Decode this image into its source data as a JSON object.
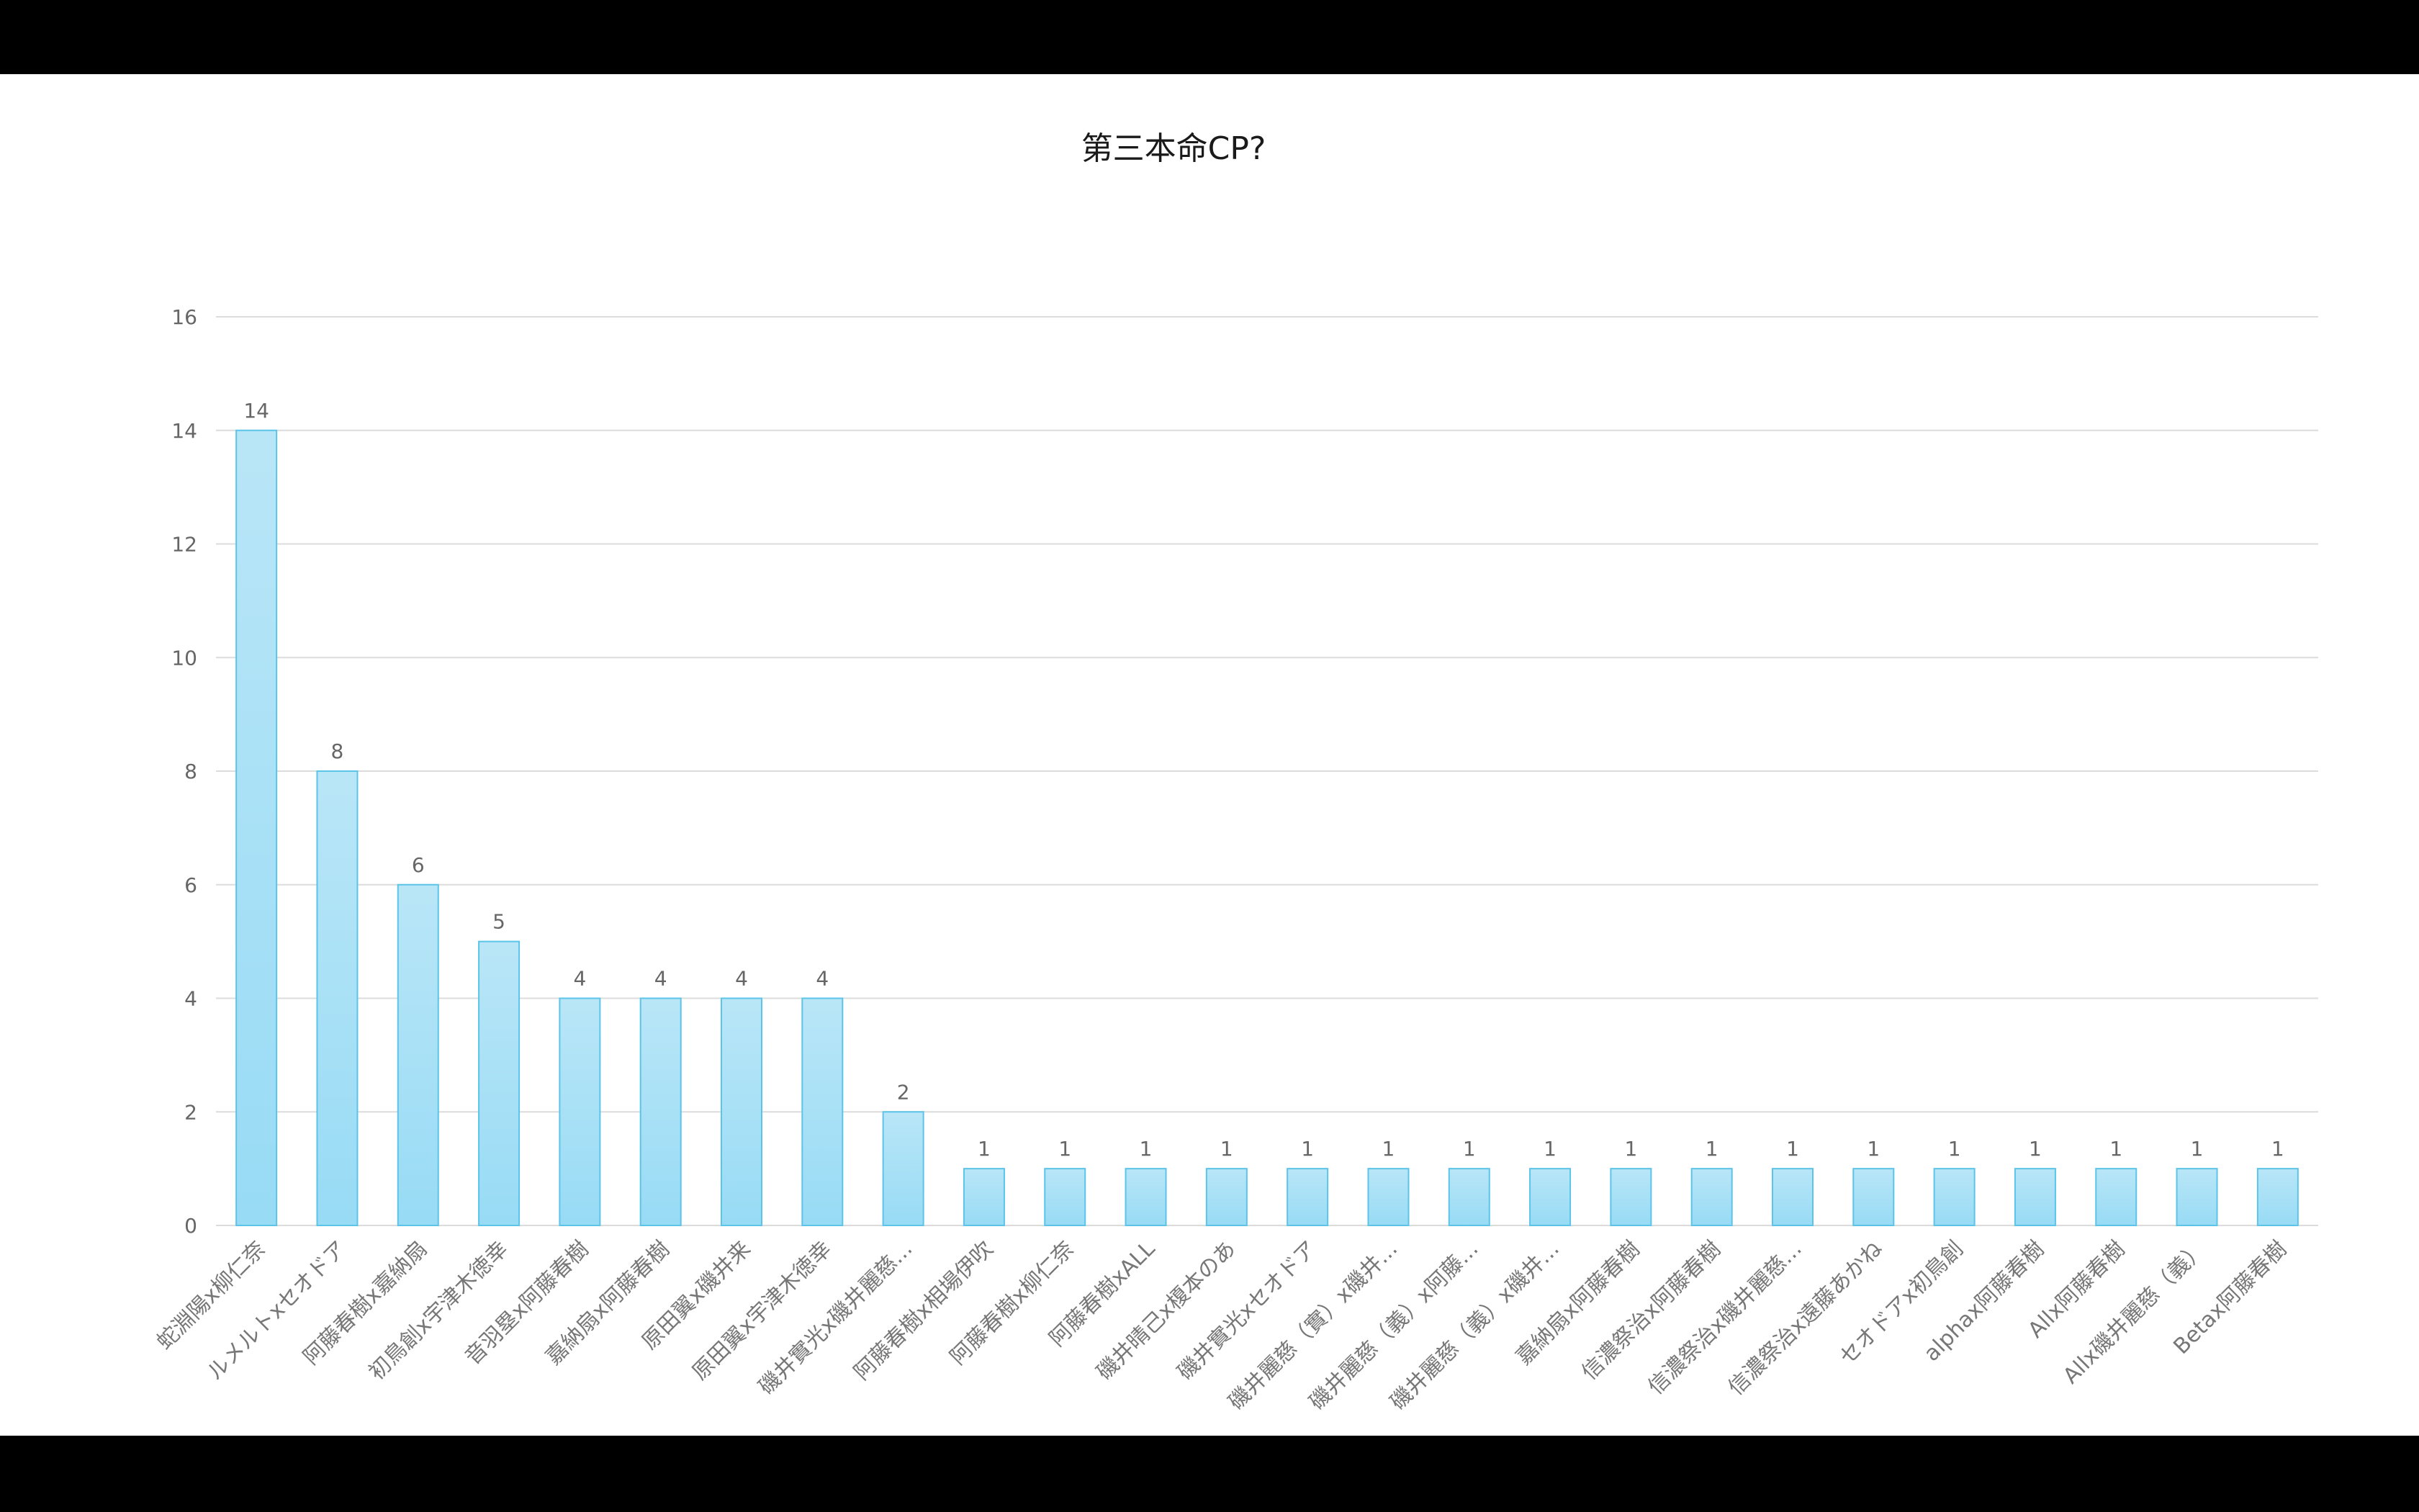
{
  "colors": {
    "background": "#ffffff",
    "frame": "#000000",
    "bar_fill_top": "#b9e6f7",
    "bar_fill_bottom": "#98dbf5",
    "bar_stroke": "#5bc4e8",
    "grid": "#dcdcdc",
    "text": "#666666"
  },
  "chart_data": {
    "type": "bar",
    "title": "第三本命CP?",
    "xlabel": "",
    "ylabel": "",
    "ylim": [
      0,
      16
    ],
    "yticks": [
      0,
      2,
      4,
      6,
      8,
      10,
      12,
      14,
      16
    ],
    "grid": true,
    "legend": "none",
    "categories": [
      "蛇淵陽x柳仁奈",
      "ルメルトxセオドア",
      "阿藤春樹x嘉納扇",
      "初鳥創x宇津木徳幸",
      "音羽塁x阿藤春樹",
      "嘉納扇x阿藤春樹",
      "原田翼x磯井来",
      "原田翼x宇津木徳幸",
      "磯井實光x磯井麗慈...",
      "阿藤春樹x相場伊吹",
      "阿藤春樹x柳仁奈",
      "阿藤春樹xALL",
      "磯井晴己x榎本のあ",
      "磯井實光xセオドア",
      "磯井麗慈（實）x磯井...",
      "磯井麗慈（義）x阿藤...",
      "磯井麗慈（義）x磯井...",
      "嘉納扇x阿藤春樹",
      "信濃祭治x阿藤春樹",
      "信濃祭治x磯井麗慈...",
      "信濃祭治x遠藤あかね",
      "セオドアx初鳥創",
      "alphax阿藤春樹",
      "Allx阿藤春樹",
      "Allx磯井麗慈（義）",
      "Betax阿藤春樹"
    ],
    "values": [
      14,
      8,
      6,
      5,
      4,
      4,
      4,
      4,
      2,
      1,
      1,
      1,
      1,
      1,
      1,
      1,
      1,
      1,
      1,
      1,
      1,
      1,
      1,
      1,
      1,
      1
    ]
  }
}
